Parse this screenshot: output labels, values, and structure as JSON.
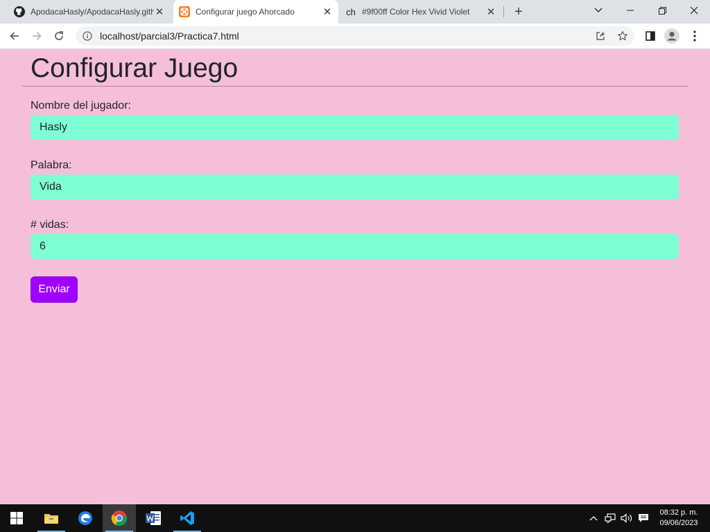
{
  "browser": {
    "tabs": [
      {
        "title": "ApodacaHasly/ApodacaHasly.gith",
        "icon": "github-icon",
        "active": false
      },
      {
        "title": "Configurar juego Ahorcado",
        "icon": "xampp-icon",
        "active": true
      },
      {
        "title": "#9f00ff Color Hex Vivid Violet",
        "icon": "colorhexa-icon",
        "active": false
      }
    ],
    "url": "localhost/parcial3/Practica7.html"
  },
  "page": {
    "heading": "Configurar Juego",
    "fields": [
      {
        "label": "Nombre del jugador:",
        "value": "Hasly"
      },
      {
        "label": "Palabra:",
        "value": "Vida"
      },
      {
        "label": "# vidas:",
        "value": "6"
      }
    ],
    "submit_label": "Enviar"
  },
  "taskbar": {
    "apps": [
      "windows-start-icon",
      "file-explorer-icon",
      "edge-icon",
      "chrome-icon",
      "word-icon",
      "vscode-icon"
    ],
    "time": "08:32 p. m.",
    "date": "09/06/2023"
  },
  "colors": {
    "page_background": "#f5bfd9",
    "input_background": "#7fffd4",
    "button_background": "#9f00ff"
  }
}
